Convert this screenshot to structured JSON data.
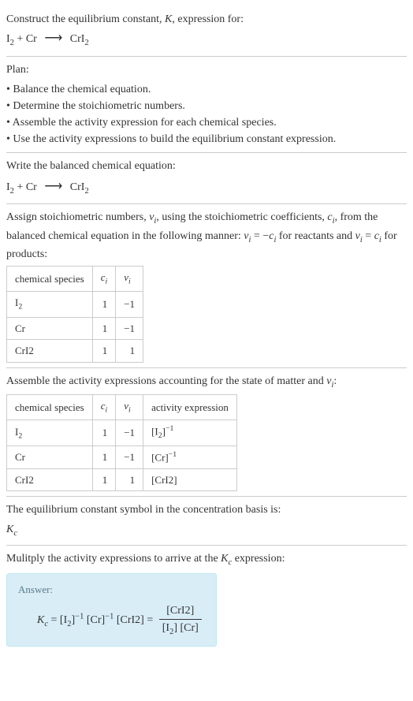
{
  "header": {
    "construct": "Construct the equilibrium constant, K, expression for:",
    "equation_lhs": "I",
    "equation_sub1": "2",
    "equation_plus": " + Cr ",
    "equation_rhs": " CrI",
    "equation_sub2": "2"
  },
  "plan": {
    "title": "Plan:",
    "items": [
      "Balance the chemical equation.",
      "Determine the stoichiometric numbers.",
      "Assemble the activity expression for each chemical species.",
      "Use the activity expressions to build the equilibrium constant expression."
    ]
  },
  "balanced": {
    "label": "Write the balanced chemical equation:"
  },
  "assign": {
    "text_a": "Assign stoichiometric numbers, ",
    "nu": "ν",
    "sub_i": "i",
    "text_b": ", using the stoichiometric coefficients, ",
    "c": "c",
    "text_c": ", from the balanced chemical equation in the following manner: ",
    "rel1_a": " = −",
    "text_d": " for reactants and ",
    "rel2_a": " = ",
    "text_e": " for products:"
  },
  "table1": {
    "headers": [
      "chemical species",
      "cᵢ",
      "νᵢ"
    ],
    "rows": [
      {
        "species_html": "I<sub>2</sub>",
        "ci": "1",
        "vi": "−1"
      },
      {
        "species_html": "Cr",
        "ci": "1",
        "vi": "−1"
      },
      {
        "species_html": "CrI2",
        "ci": "1",
        "vi": "1"
      }
    ]
  },
  "assemble": {
    "text": "Assemble the activity expressions accounting for the state of matter and νᵢ:"
  },
  "table2": {
    "headers": [
      "chemical species",
      "cᵢ",
      "νᵢ",
      "activity expression"
    ],
    "rows": [
      {
        "species_html": "I<sub>2</sub>",
        "ci": "1",
        "vi": "−1",
        "act_html": "[I<sub>2</sub>]<sup>−1</sup>"
      },
      {
        "species_html": "Cr",
        "ci": "1",
        "vi": "−1",
        "act_html": "[Cr]<sup>−1</sup>"
      },
      {
        "species_html": "CrI2",
        "ci": "1",
        "vi": "1",
        "act_html": "[CrI2]"
      }
    ]
  },
  "symbol": {
    "text": "The equilibrium constant symbol in the concentration basis is:",
    "kc": "Kc"
  },
  "multiply": {
    "text_a": "Mulitply the activity expressions to arrive at the ",
    "text_b": " expression:"
  },
  "answer": {
    "label": "Answer:",
    "kc_lhs": "Kc",
    "eq": " = ",
    "term1": "[I2]",
    "exp1": "−1",
    "term2": "[Cr]",
    "exp2": "−1",
    "term3": "[CrI2]",
    "frac_num": "[CrI2]",
    "frac_den": "[I2] [Cr]"
  },
  "chart_data": {
    "type": "table",
    "tables": [
      {
        "name": "stoichiometric numbers",
        "headers": [
          "chemical species",
          "c_i",
          "nu_i"
        ],
        "rows": [
          [
            "I2",
            1,
            -1
          ],
          [
            "Cr",
            1,
            -1
          ],
          [
            "CrI2",
            1,
            1
          ]
        ]
      },
      {
        "name": "activity expressions",
        "headers": [
          "chemical species",
          "c_i",
          "nu_i",
          "activity expression"
        ],
        "rows": [
          [
            "I2",
            1,
            -1,
            "[I2]^-1"
          ],
          [
            "Cr",
            1,
            -1,
            "[Cr]^-1"
          ],
          [
            "CrI2",
            1,
            1,
            "[CrI2]"
          ]
        ]
      }
    ],
    "equation": "I2 + Cr -> CrI2",
    "equilibrium_constant": "Kc = [CrI2] / ([I2][Cr])"
  }
}
